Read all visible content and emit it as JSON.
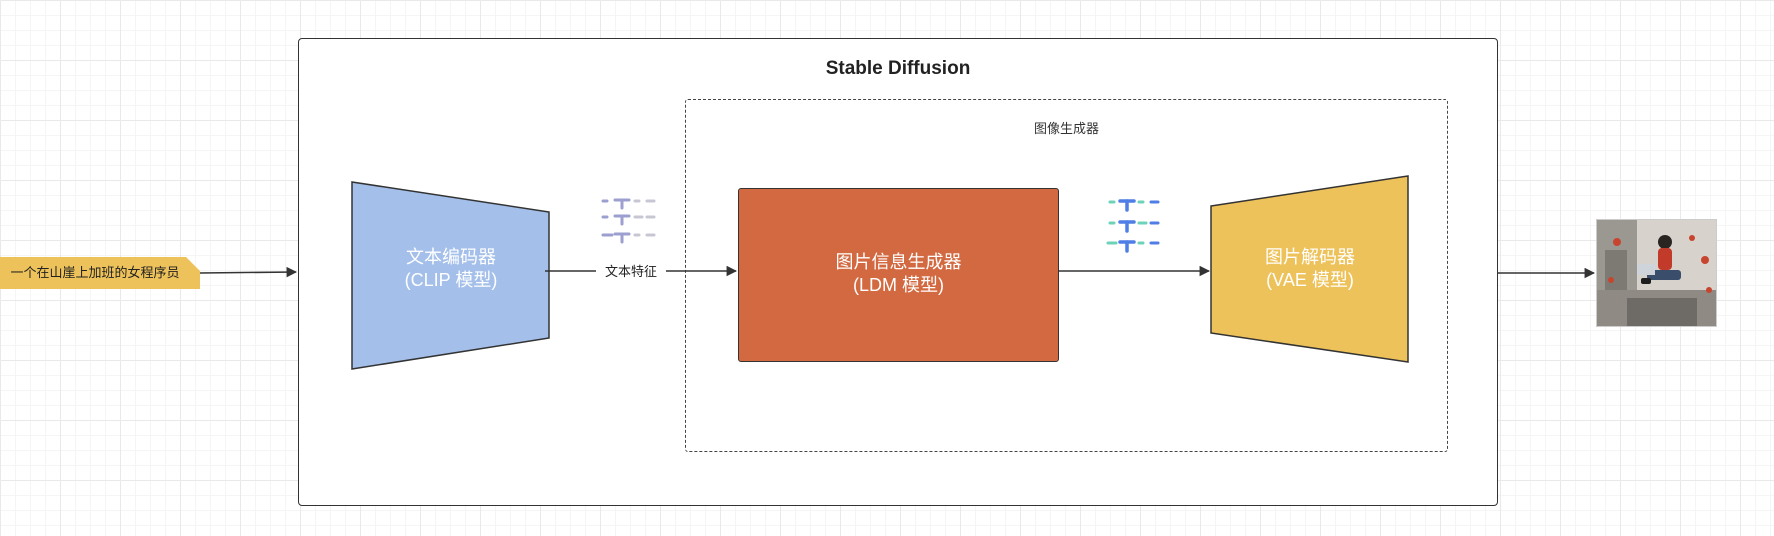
{
  "diagram": {
    "title": "Stable Diffusion",
    "image_generator_label": "图像生成器",
    "input_prompt": "一个在山崖上加班的女程序员",
    "text_encoder": {
      "line1": "文本编码器",
      "line2": "(CLIP 模型)"
    },
    "text_feature_label": "文本特征",
    "image_info_creator": {
      "line1": "图片信息生成器",
      "line2": "(LDM 模型)"
    },
    "image_decoder": {
      "line1": "图片解码器",
      "line2": "(VAE 模型)"
    }
  },
  "colors": {
    "text_encoder": "#a3bfea",
    "image_info_creator": "#d36940",
    "image_decoder": "#eec25a",
    "input_tag": "#eec25a",
    "token_lilac": "#9c9fcf",
    "token_teal": "#6cd3b8",
    "token_blue": "#4f7ee6",
    "token_gray": "#c7c7d4"
  },
  "icons": {
    "text_tokens": "text-token-grid-icon",
    "latent_tokens": "latent-token-grid-icon",
    "output_image": "generated-illustration"
  }
}
